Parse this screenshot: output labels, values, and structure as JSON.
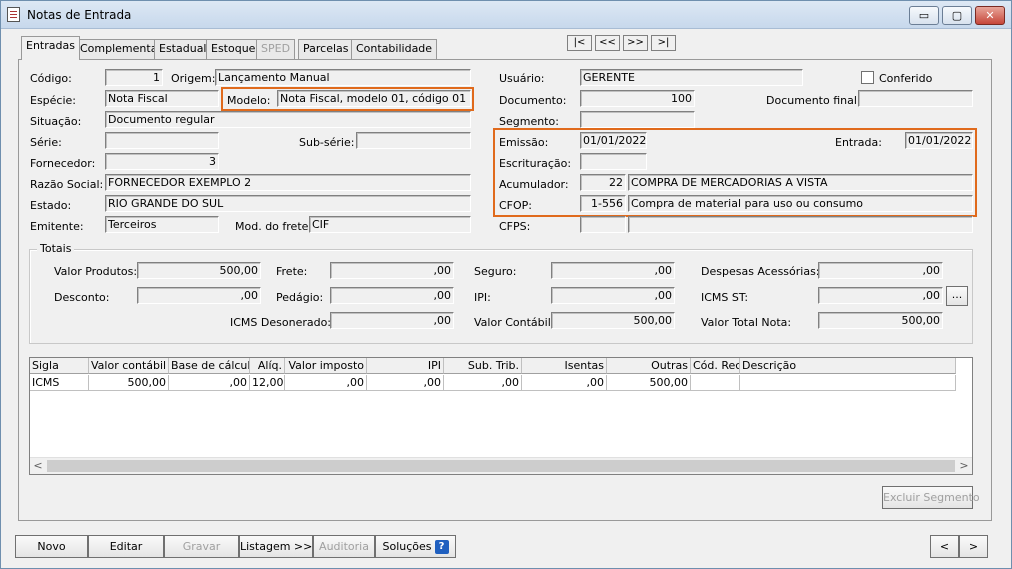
{
  "window": {
    "title": "Notas de Entrada"
  },
  "tabs": [
    {
      "label": "Entradas"
    },
    {
      "label": "Complementar"
    },
    {
      "label": "Estadual"
    },
    {
      "label": "Estoque"
    },
    {
      "label": "SPED"
    },
    {
      "label": "Parcelas"
    },
    {
      "label": "Contabilidade"
    }
  ],
  "nav": {
    "first": "|<",
    "prev": "<<",
    "next": ">>",
    "last": ">|"
  },
  "form": {
    "codigo": {
      "label": "Código:",
      "value": "1"
    },
    "origem": {
      "label": "Origem:",
      "value": "Lançamento Manual"
    },
    "especie": {
      "label": "Espécie:",
      "value": "Nota Fiscal"
    },
    "modelo": {
      "label": "Modelo:",
      "value": "Nota Fiscal, modelo 01, código 01"
    },
    "situacao": {
      "label": "Situação:",
      "value": "Documento regular"
    },
    "serie": {
      "label": "Série:",
      "value": ""
    },
    "subserie": {
      "label": "Sub-série:",
      "value": ""
    },
    "fornecedor": {
      "label": "Fornecedor:",
      "value": "3"
    },
    "razao_social": {
      "label": "Razão Social:",
      "value": "FORNECEDOR EXEMPLO 2"
    },
    "estado": {
      "label": "Estado:",
      "value": "RIO GRANDE DO SUL"
    },
    "emitente": {
      "label": "Emitente:",
      "value": "Terceiros"
    },
    "mod_frete": {
      "label": "Mod. do frete:",
      "value": "CIF"
    },
    "usuario": {
      "label": "Usuário:",
      "value": "GERENTE"
    },
    "conferido": {
      "label": "Conferido"
    },
    "documento": {
      "label": "Documento:",
      "value": "100"
    },
    "documento_final": {
      "label": "Documento final:",
      "value": ""
    },
    "segmento": {
      "label": "Segmento:",
      "value": ""
    },
    "emissao": {
      "label": "Emissão:",
      "value": "01/01/2022"
    },
    "entrada": {
      "label": "Entrada:",
      "value": "01/01/2022"
    },
    "escrituracao": {
      "label": "Escrituração:",
      "value": ""
    },
    "acumulador": {
      "label": "Acumulador:",
      "code": "22",
      "value": "COMPRA DE MERCADORIAS A VISTA"
    },
    "cfop": {
      "label": "CFOP:",
      "code": "1-556",
      "value": "Compra de material para uso ou consumo"
    },
    "cfps": {
      "label": "CFPS:",
      "code": "",
      "value": ""
    }
  },
  "totais": {
    "title": "Totais",
    "valor_produtos": {
      "label": "Valor Produtos:",
      "value": "500,00"
    },
    "frete": {
      "label": "Frete:",
      "value": ",00"
    },
    "seguro": {
      "label": "Seguro:",
      "value": ",00"
    },
    "despesas": {
      "label": "Despesas Acessórias:",
      "value": ",00"
    },
    "desconto": {
      "label": "Desconto:",
      "value": ",00"
    },
    "pedagio": {
      "label": "Pedágio:",
      "value": ",00"
    },
    "ipi": {
      "label": "IPI:",
      "value": ",00"
    },
    "icms_st": {
      "label": "ICMS ST:",
      "value": ",00",
      "button": "..."
    },
    "icms_desonerado": {
      "label": "ICMS Desonerado:",
      "value": ",00"
    },
    "valor_contabil": {
      "label": "Valor Contábil:",
      "value": "500,00"
    },
    "valor_total_nota": {
      "label": "Valor Total Nota:",
      "value": "500,00"
    }
  },
  "grid": {
    "columns": [
      "Sigla",
      "Valor contábil",
      "Base de cálculo",
      "Alíq.",
      "Valor imposto",
      "IPI",
      "Sub. Trib.",
      "Isentas",
      "Outras",
      "Cód. Rec.",
      "Descrição"
    ],
    "rows": [
      [
        "ICMS",
        "500,00",
        ",00",
        "12,00",
        ",00",
        ",00",
        ",00",
        ",00",
        "500,00",
        "",
        ""
      ]
    ],
    "scroll_left": "<",
    "scroll_right": ">"
  },
  "excluir_segmento": "Excluir Segmento",
  "buttons": {
    "novo": "Novo",
    "editar": "Editar",
    "gravar": "Gravar",
    "listagem": "Listagem >>",
    "auditoria": "Auditoria",
    "solucoes": "Soluções",
    "help": "?",
    "prev": "<",
    "next": ">"
  },
  "window_buttons": {
    "minimize": "▭",
    "maximize": "▢",
    "close": "✕"
  }
}
